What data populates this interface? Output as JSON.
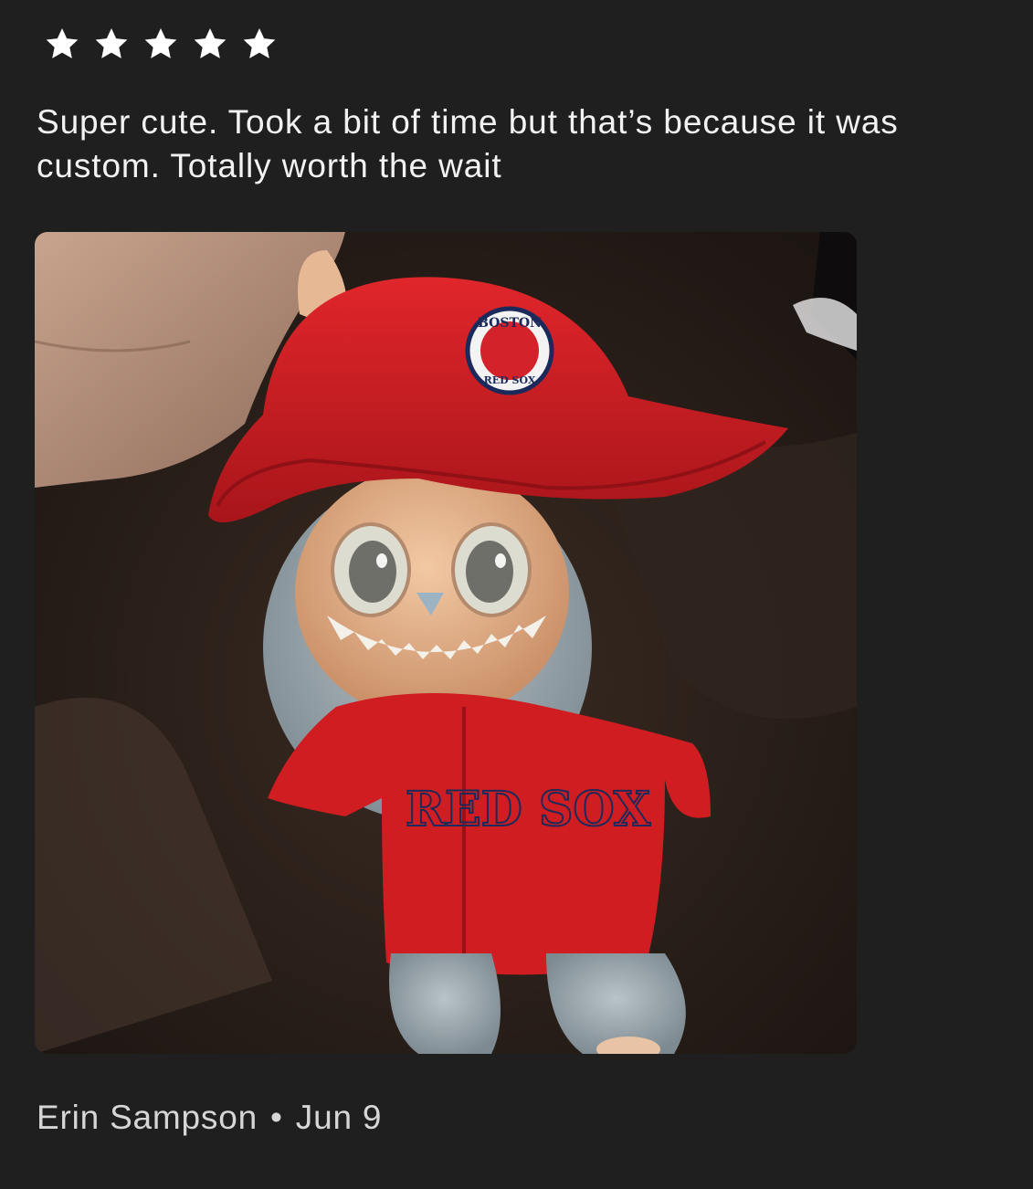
{
  "review": {
    "rating": 5,
    "rating_max": 5,
    "text": "Super cute. Took a bit of time but that’s because it was custom. Totally worth the wait",
    "photo": {
      "subject": "plush-doll-in-red-cap-and-jersey",
      "cap_patch_text": "BOSTON",
      "cap_patch_bottom_text": "RED SOX",
      "jersey_text": "RED SOX"
    },
    "author": "Erin Sampson",
    "separator": "•",
    "date": "Jun 9"
  },
  "colors": {
    "background": "#1f1f1f",
    "text": "#f2f2f2",
    "byline": "#d6d6d6",
    "star": "#ffffff",
    "hat_red": "#d21d22",
    "jersey_navy": "#1b2a5a"
  },
  "icons": {
    "star": "star-icon"
  }
}
